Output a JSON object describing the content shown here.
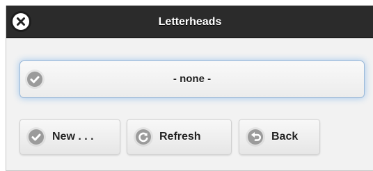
{
  "dialog": {
    "title": "Letterheads",
    "close_icon": "close-icon"
  },
  "selection": {
    "label": "- none -",
    "icon": "check-icon"
  },
  "buttons": [
    {
      "label": "New . . .",
      "icon": "check-icon"
    },
    {
      "label": "Refresh",
      "icon": "refresh-icon"
    },
    {
      "label": "Back",
      "icon": "back-arrow-icon"
    }
  ]
}
